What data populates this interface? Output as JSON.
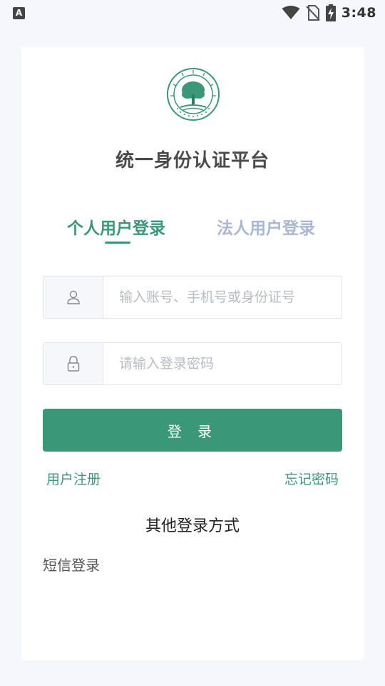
{
  "status_bar": {
    "notification_icon": "A",
    "time": "3:48",
    "icons": [
      "wifi-icon",
      "no-sim-icon",
      "battery-charging-icon"
    ]
  },
  "login": {
    "title": "统一身份认证平台",
    "tabs": [
      {
        "label": "个人用户登录",
        "active": true
      },
      {
        "label": "法人用户登录",
        "active": false
      }
    ],
    "account_placeholder": "输入账号、手机号或身份证号",
    "password_placeholder": "请输入登录密码",
    "login_button": "登 录",
    "register_link": "用户注册",
    "forgot_link": "忘记密码",
    "other_methods_title": "其他登录方式",
    "sms_login": "短信登录"
  },
  "colors": {
    "accent": "#3a9878",
    "inactive_tab": "#a9b7d4",
    "background": "#f5f7fc"
  }
}
